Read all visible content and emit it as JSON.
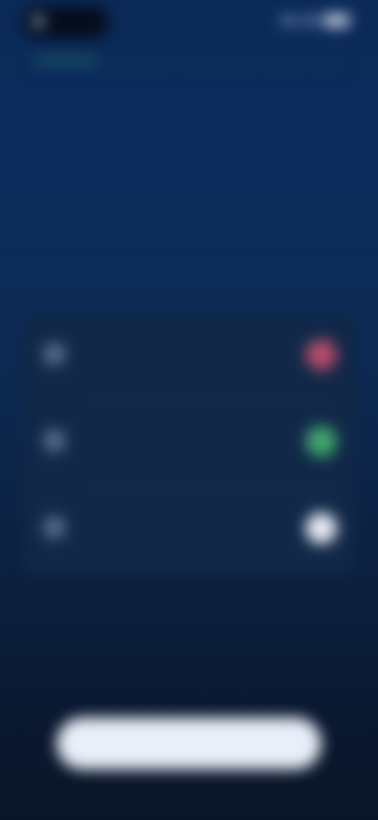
{
  "status_bar": {
    "time": "",
    "icons": [
      "signal-icon",
      "wifi-icon",
      "battery-icon"
    ]
  },
  "header": {
    "label": ""
  },
  "main": {
    "headline": "",
    "subtext": ""
  },
  "permissions": [
    {
      "title": "",
      "description": "",
      "icon": "item-icon",
      "toggle_color": "#b34d6b"
    },
    {
      "title": "",
      "description": "",
      "icon": "item-icon",
      "toggle_color": "#3fa76b"
    },
    {
      "title": "",
      "description": "",
      "icon": "item-icon",
      "toggle_color": "#e8ecf6"
    }
  ],
  "footer": {
    "cta_label": ""
  },
  "colors": {
    "accent_green": "#2f8f6a",
    "background": "#0b2a57"
  }
}
